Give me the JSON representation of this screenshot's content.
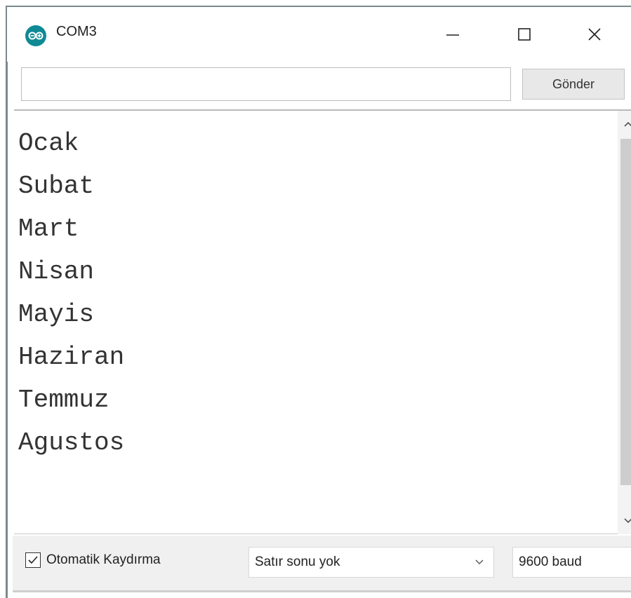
{
  "window": {
    "title": "COM3",
    "icon": "arduino-icon",
    "controls": [
      "minimize-icon",
      "maximize-icon",
      "close-icon"
    ]
  },
  "send": {
    "input_value": "",
    "button_label": "Gönder"
  },
  "output": {
    "lines": [
      "Ocak",
      "Subat",
      "Mart",
      "Nisan",
      "Mayis",
      "Haziran",
      "Temmuz",
      "Agustos"
    ]
  },
  "status": {
    "autoscroll_label": "Otomatik Kaydırma",
    "autoscroll_checked": true,
    "line_ending": "Satır sonu yok",
    "baud": "9600 baud"
  },
  "colors": {
    "app_icon": "#0f8a95",
    "status_bg": "#f0f0f0",
    "scroll_thumb": "#cdcdcd"
  }
}
